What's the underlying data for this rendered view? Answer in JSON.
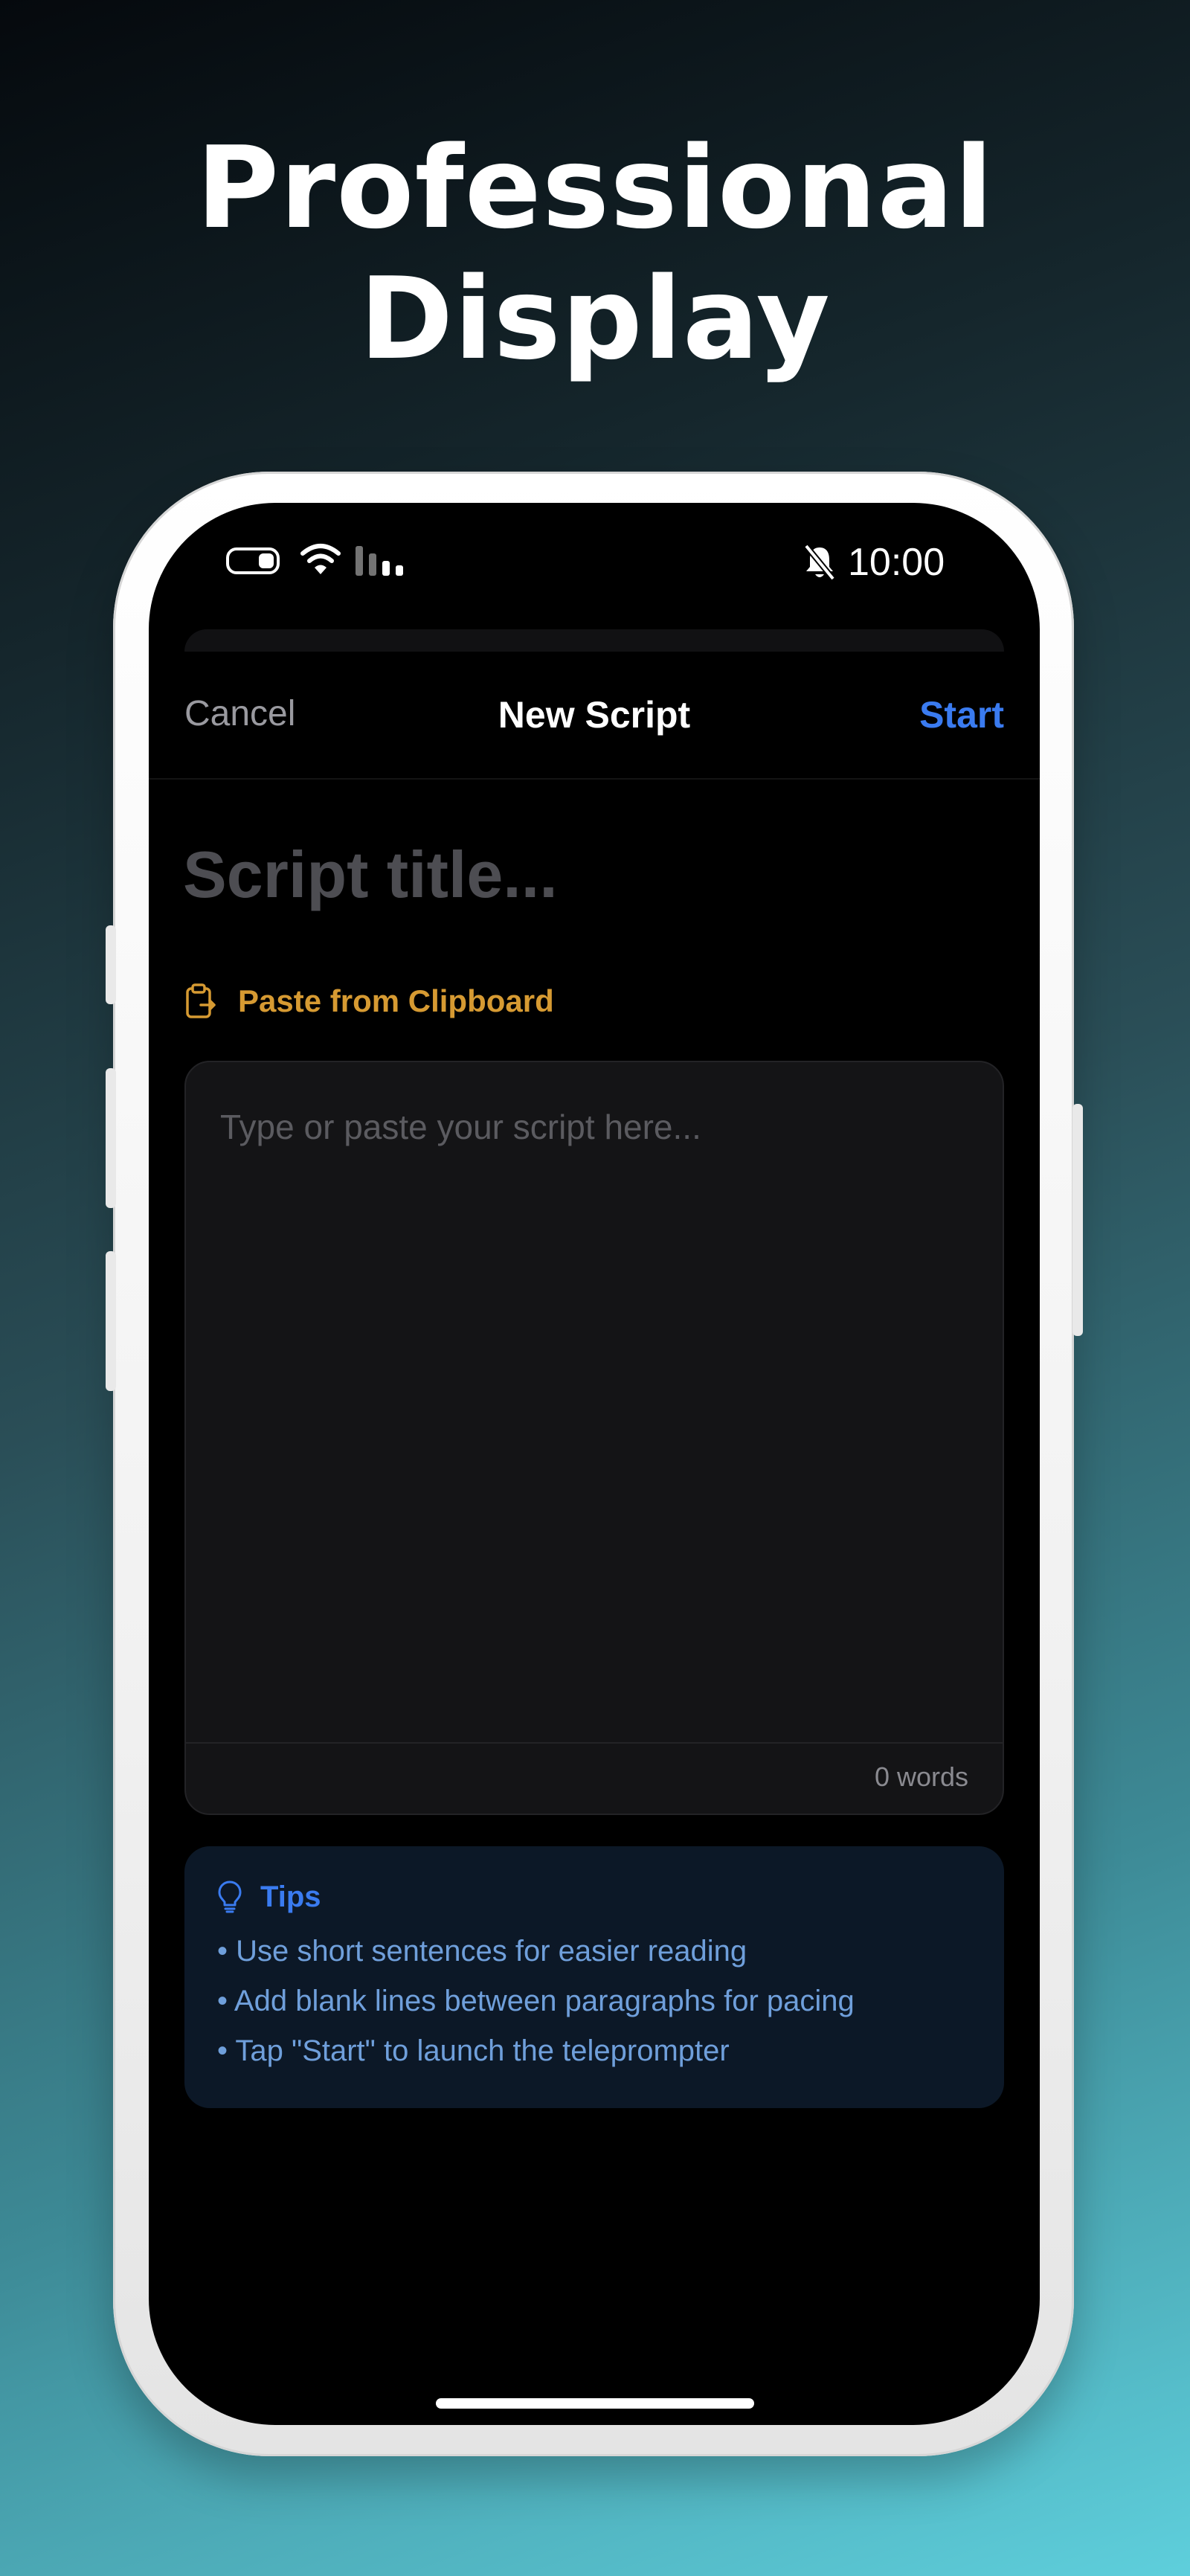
{
  "headline": {
    "line1": "Professional",
    "line2": "Display"
  },
  "status_bar": {
    "time": "10:00",
    "icons": [
      "battery-icon",
      "wifi-icon",
      "signal-icon",
      "bell-off-icon"
    ]
  },
  "nav": {
    "cancel_label": "Cancel",
    "title": "New Script",
    "start_label": "Start"
  },
  "script_title": {
    "placeholder": "Script title...",
    "value": ""
  },
  "paste": {
    "label": "Paste from Clipboard",
    "icon": "clipboard-icon"
  },
  "editor": {
    "placeholder": "Type or paste your script here...",
    "value": "",
    "word_count": "0 words"
  },
  "tips": {
    "title": "Tips",
    "icon": "lightbulb-icon",
    "items": [
      "• Use short sentences for easier reading",
      "• Add blank lines between paragraphs for pacing",
      "• Tap \"Start\" to launch the teleprompter"
    ]
  },
  "colors": {
    "accent_blue": "#3a7bf0",
    "paste_orange": "#d69a32",
    "tip_text": "#6f9fdb",
    "tips_background": "#0c1827",
    "editor_background": "#141416"
  }
}
